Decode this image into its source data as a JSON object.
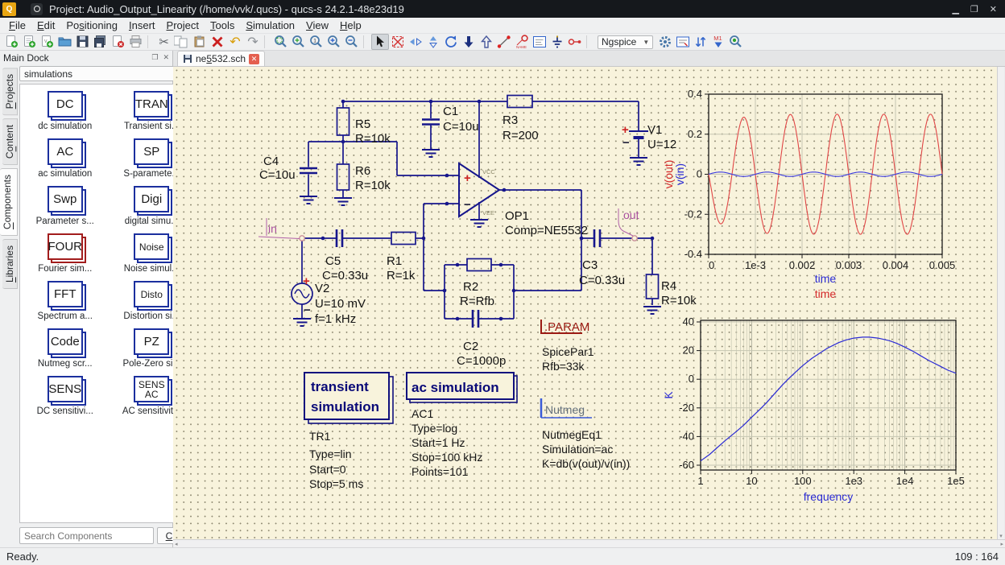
{
  "window": {
    "title": "Project: Audio_Output_Linearity (/home/vvk/.qucs) - qucs-s 24.2.1-48e23d19",
    "controls": [
      "minimize",
      "maximize",
      "close"
    ]
  },
  "menu": {
    "items": [
      {
        "pre": "",
        "key": "F",
        "post": "ile"
      },
      {
        "pre": "",
        "key": "E",
        "post": "dit"
      },
      {
        "pre": "Po",
        "key": "s",
        "post": "itioning"
      },
      {
        "pre": "",
        "key": "I",
        "post": "nsert"
      },
      {
        "pre": "",
        "key": "P",
        "post": "roject"
      },
      {
        "pre": "",
        "key": "T",
        "post": "ools"
      },
      {
        "pre": "",
        "key": "S",
        "post": "imulation"
      },
      {
        "pre": "",
        "key": "V",
        "post": "iew"
      },
      {
        "pre": "",
        "key": "H",
        "post": "elp"
      }
    ]
  },
  "toolbar": {
    "simulator": "Ngspice",
    "items": [
      "new-document",
      "new-text-document",
      "new-verilog-document",
      "open-file",
      "save-file",
      "save-all",
      "close-document",
      "print",
      "sep",
      "cut",
      "copy",
      "paste",
      "delete",
      "undo",
      "redo",
      "sep",
      "zoom-fit",
      "zoom-window",
      "zoom-1-1",
      "zoom-in",
      "zoom-out",
      "sep",
      "select",
      "deactivate",
      "mirror-y",
      "mirror-x",
      "rotate",
      "push-down",
      "pop-up",
      "wire",
      "node-name",
      "equation",
      "ground",
      "port",
      "sep",
      "simulator-select",
      "simulate-gear",
      "sim-settings",
      "exchange",
      "marker",
      "probe"
    ]
  },
  "dock": {
    "title": "Main Dock",
    "tabs": [
      {
        "pre": "",
        "key": "P",
        "post": "rojects"
      },
      {
        "pre": "C",
        "key": "o",
        "post": "ntent"
      },
      {
        "pre": "",
        "key": "C",
        "post": "omponents"
      },
      {
        "pre": "",
        "key": "L",
        "post": "ibraries"
      }
    ],
    "category": "simulations",
    "components": [
      {
        "icon": "DC",
        "caption": "dc simulation",
        "accent": "blue"
      },
      {
        "icon": "TRAN",
        "caption": "Transient si...",
        "accent": "blue"
      },
      {
        "icon": "AC",
        "caption": "ac simulation",
        "accent": "blue"
      },
      {
        "icon": "SP",
        "caption": "S-paramete...",
        "accent": "blue"
      },
      {
        "icon": "Swp",
        "caption": "Parameter s...",
        "accent": "blue"
      },
      {
        "icon": "Digi",
        "caption": "digital simu...",
        "accent": "blue"
      },
      {
        "icon": "FOUR",
        "caption": "Fourier sim...",
        "accent": "red"
      },
      {
        "icon": "Noise",
        "caption": "Noise simul...",
        "accent": "blue"
      },
      {
        "icon": "FFT",
        "caption": "Spectrum a...",
        "accent": "blue"
      },
      {
        "icon": "Disto",
        "caption": "Distortion si...",
        "accent": "blue"
      },
      {
        "icon": "Code",
        "caption": "Nutmeg scr...",
        "accent": "blue"
      },
      {
        "icon": "PZ",
        "caption": "Pole-Zero si...",
        "accent": "blue"
      },
      {
        "icon": "SENS",
        "caption": "DC sensitivi...",
        "accent": "blue"
      },
      {
        "icon": "SENS AC",
        "caption": "AC sensitivit...",
        "accent": "blue"
      }
    ],
    "search_placeholder": "Search Components",
    "clear_label_pre": "",
    "clear_label_key": "C",
    "clear_label_post": "lear"
  },
  "editor": {
    "tab": {
      "pre": "ne",
      "key": "5",
      "post": "532.sch"
    }
  },
  "schematic": {
    "r1": {
      "name": "R1",
      "value": "R=1k"
    },
    "r2": {
      "name": "R2",
      "value": "R=Rfb"
    },
    "r3": {
      "name": "R3",
      "value": "R=200"
    },
    "r4": {
      "name": "R4",
      "value": "R=10k"
    },
    "r5": {
      "name": "R5",
      "value": "R=10k"
    },
    "r6": {
      "name": "R6",
      "value": "R=10k"
    },
    "c1": {
      "name": "C1",
      "value": "C=10u"
    },
    "c2": {
      "name": "C2",
      "value": "C=1000p"
    },
    "c3": {
      "name": "C3",
      "value": "C=0.33u"
    },
    "c4": {
      "name": "C4",
      "value": "C=10u"
    },
    "c5": {
      "name": "C5",
      "value": "C=0.33u"
    },
    "v1": {
      "name": "V1",
      "value": "U=12",
      "plus": "+",
      "minus": "−"
    },
    "v2": {
      "name": "V2",
      "value1": "U=10 mV",
      "value2": "f=1 kHz",
      "plus": "+",
      "minus": "−"
    },
    "opamp": {
      "name": "OP1",
      "value": "Comp=NE5532",
      "plus": "+",
      "minus": "−",
      "vcc": "VCC",
      "vee": "VEE"
    },
    "port_in": "in",
    "port_out": "out",
    "param": {
      "title": ".PARAM",
      "lines": [
        "SpicePar1",
        "Rfb=33k"
      ]
    },
    "transient": {
      "title1": "transient",
      "title2": "simulation",
      "lines": [
        "TR1",
        "Type=lin",
        "Start=0",
        "Stop=5 ms"
      ]
    },
    "ac": {
      "title": "ac simulation",
      "lines": [
        "AC1",
        "Type=log",
        "Start=1 Hz",
        "Stop=100 kHz",
        "Points=101"
      ]
    },
    "nutmeg": {
      "title": "Nutmeg",
      "lines": [
        "NutmegEq1",
        "Simulation=ac",
        "K=db(v(out)/v(in))"
      ]
    }
  },
  "chart_data": [
    {
      "id": "transient-plot",
      "type": "line",
      "x_axis": {
        "title_blue": "time",
        "title_red": "time",
        "range": [
          0,
          0.005
        ],
        "tick_values": [
          0,
          0.001,
          0.002,
          0.003,
          0.004,
          0.005
        ],
        "tick_labels": [
          "0",
          "1e-3",
          "0.002",
          "0.003",
          "0.004",
          "0.005"
        ]
      },
      "y_axis": {
        "range": [
          -0.4,
          0.4
        ],
        "tick_values": [
          0.4,
          0.2,
          0,
          -0.2,
          -0.4
        ],
        "tick_labels": [
          "0.4",
          "0.2",
          "0",
          "-0.2",
          "-0.4"
        ],
        "rotated_labels": [
          {
            "text": "v(out)",
            "color": "#d42a2a"
          },
          {
            "text": "v(in)",
            "color": "#2a2ad4"
          }
        ]
      },
      "series": [
        {
          "name": "v(out)",
          "color": "#e04545",
          "waveform": "sine",
          "amplitude": 0.3,
          "frequency_hz": 1000,
          "inverted": true,
          "startup_fraction": 0.33,
          "startup_tau": 0.0004
        },
        {
          "name": "v(in)",
          "color": "#3a3ae0",
          "waveform": "sine",
          "amplitude": 0.011,
          "frequency_hz": 1000,
          "inverted": false,
          "startup_fraction": 0,
          "startup_tau": 0
        }
      ]
    },
    {
      "id": "ac-plot",
      "type": "line",
      "x_scale": "log",
      "x_axis": {
        "title": "frequency",
        "range": [
          1,
          100000
        ],
        "tick_values": [
          1,
          10,
          100,
          1000,
          10000,
          100000
        ],
        "tick_labels": [
          "1",
          "10",
          "100",
          "1e3",
          "1e4",
          "1e5"
        ]
      },
      "y_axis": {
        "title": "K",
        "range": [
          -60,
          40
        ],
        "tick_values": [
          40,
          20,
          0,
          -20,
          -40,
          -60
        ],
        "tick_labels": [
          "40",
          "20",
          "0",
          "-20",
          "-40",
          "-60"
        ]
      },
      "series": [
        {
          "name": "K",
          "color": "#2a2ad4",
          "points": [
            [
              1,
              -57
            ],
            [
              1.5,
              -52.5
            ],
            [
              2,
              -48.5
            ],
            [
              3,
              -43
            ],
            [
              5,
              -36.5
            ],
            [
              7,
              -32
            ],
            [
              10,
              -26.5
            ],
            [
              15,
              -20.5
            ],
            [
              20,
              -16
            ],
            [
              30,
              -9
            ],
            [
              40,
              -4
            ],
            [
              50,
              -0.5
            ],
            [
              70,
              4.5
            ],
            [
              100,
              9.5
            ],
            [
              150,
              14.5
            ],
            [
              200,
              17.5
            ],
            [
              300,
              21.5
            ],
            [
              500,
              25.5
            ],
            [
              700,
              27.4
            ],
            [
              1000,
              28.7
            ],
            [
              1500,
              29.4
            ],
            [
              2000,
              29.4
            ],
            [
              3000,
              28.7
            ],
            [
              5000,
              26.9
            ],
            [
              7000,
              25
            ],
            [
              10000,
              22.4
            ],
            [
              15000,
              19.2
            ],
            [
              20000,
              16.6
            ],
            [
              30000,
              13
            ],
            [
              50000,
              9
            ],
            [
              70000,
              6.3
            ],
            [
              100000,
              4.2
            ]
          ]
        }
      ]
    }
  ],
  "statusbar": {
    "left": "Ready.",
    "right": "109 : 164"
  }
}
